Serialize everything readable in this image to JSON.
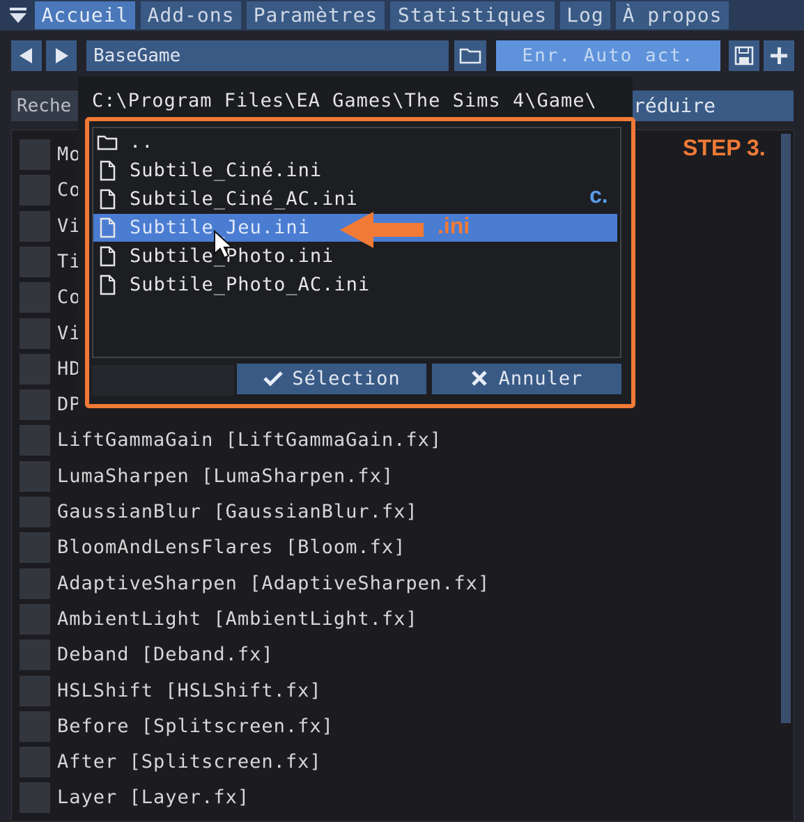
{
  "tabs": [
    {
      "label": "Accueil",
      "active": true
    },
    {
      "label": "Add-ons"
    },
    {
      "label": "Paramètres"
    },
    {
      "label": "Statistiques"
    },
    {
      "label": "Log"
    },
    {
      "label": "À propos"
    }
  ],
  "toolbar": {
    "preset_name": "BaseGame",
    "auto_save_label": "Enr. Auto act.",
    "icons": [
      "menu-toggle-icon",
      "arrow-left-icon",
      "arrow-right-icon",
      "folder-icon",
      "save-icon",
      "plus-icon"
    ]
  },
  "search": {
    "label": "Reche",
    "collapse_label": "réduire"
  },
  "effects": [
    "Mo",
    "Co",
    "Vi",
    "Ti",
    "Co",
    "Vi",
    "HD",
    "DP",
    "LiftGammaGain [LiftGammaGain.fx]",
    "LumaSharpen [LumaSharpen.fx]",
    "GaussianBlur [GaussianBlur.fx]",
    "BloomAndLensFlares [Bloom.fx]",
    "AdaptiveSharpen [AdaptiveSharpen.fx]",
    "AmbientLight [AmbientLight.fx]",
    "Deband [Deband.fx]",
    "HSLShift [HSLShift.fx]",
    "Before [Splitscreen.fx]",
    "After [Splitscreen.fx]",
    "Layer [Layer.fx]"
  ],
  "popup": {
    "path": "C:\\Program Files\\EA Games\\The Sims 4\\Game\\",
    "files": [
      {
        "name": "..",
        "type": "folder"
      },
      {
        "name": "Subtile_Ciné.ini",
        "type": "file"
      },
      {
        "name": "Subtile_Ciné_AC.ini",
        "type": "file"
      },
      {
        "name": "Subtile_Jeu.ini",
        "type": "file",
        "selected": true
      },
      {
        "name": "Subtile_Photo.ini",
        "type": "file"
      },
      {
        "name": "Subtile_Photo_AC.ini",
        "type": "file"
      }
    ],
    "select_label": "Sélection",
    "cancel_label": "Annuler"
  },
  "annotations": {
    "step": "STEP 3.",
    "sub": "c.",
    "ext": ".ini",
    "color": "#f07a36",
    "accent": "#5b9be8"
  },
  "colors": {
    "tab_bg": "#3a5a86",
    "tab_active": "#4a78ba",
    "selected": "#4a7cd2",
    "background": "#1c1c20"
  }
}
